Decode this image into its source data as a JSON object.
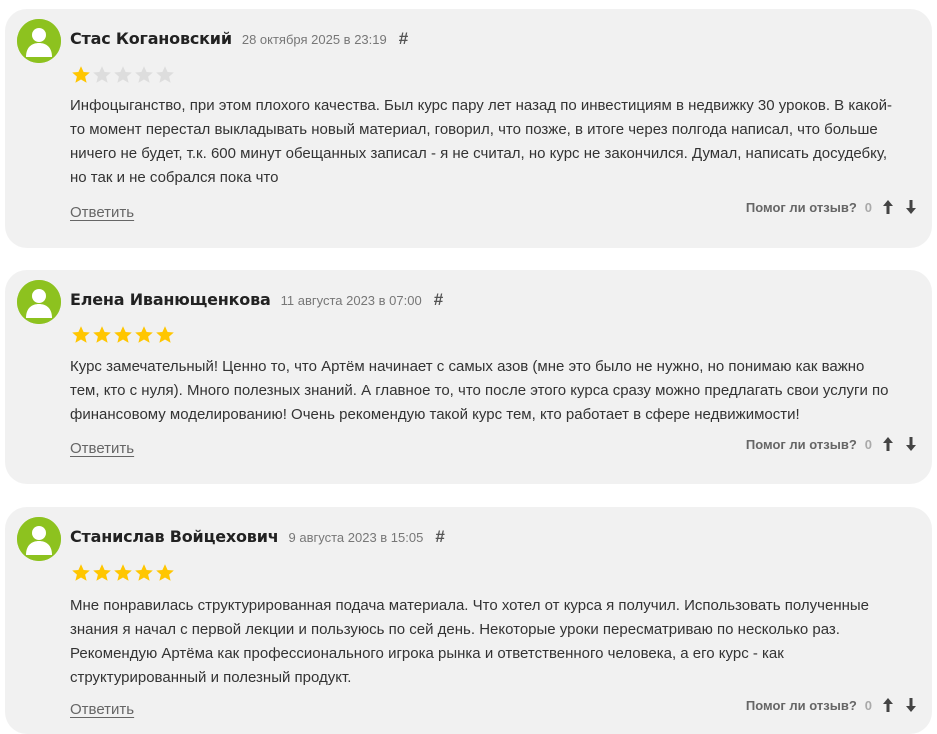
{
  "colors": {
    "card_bg": "#f1f1f1",
    "avatar_bg": "#8dc21f",
    "star_filled": "#ffc600",
    "star_empty": "#dddddd"
  },
  "reviews": [
    {
      "author": "Стас Когановский",
      "date": "28 октября 2025 в 23:19",
      "hash": "#",
      "rating": 1,
      "rating_max": 5,
      "text": "Инфоцыганство, при этом плохого качества. Был курс пару лет назад по инвестициям в недвижку 30 уроков. В какой-то момент перестал выкладывать новый материал, говорил, что позже, в итоге через полгода написал, что больше ничего не будет, т.к. 600 минут обещанных записал - я не считал, но курс не закончился. Думал, написать досудебку, но так и не собрался пока что",
      "reply_label": "Ответить",
      "helpful_label": "Помог ли отзыв?",
      "helpful_count": "0",
      "upvote_icon": "arrow-up-icon",
      "downvote_icon": "arrow-down-icon"
    },
    {
      "author": "Елена Иванющенкова",
      "date": "11 августа 2023 в 07:00",
      "hash": "#",
      "rating": 5,
      "rating_max": 5,
      "text": "Курс замечательный! Ценно то, что Артём начинает с самых азов (мне это было не нужно, но понимаю как важно тем, кто с нуля). Много полезных знаний. А главное то, что после этого курса сразу можно предлагать свои услуги по финансовому моделированию! Очень рекомендую такой курс тем, кто работает в сфере недвижимости!",
      "reply_label": "Ответить",
      "helpful_label": "Помог ли отзыв?",
      "helpful_count": "0",
      "upvote_icon": "arrow-up-icon",
      "downvote_icon": "arrow-down-icon"
    },
    {
      "author": "Станислав Войцехович",
      "date": "9 августа 2023 в 15:05",
      "hash": "#",
      "rating": 5,
      "rating_max": 5,
      "text": "Мне понравилась структурированная подача материала. Что хотел от курса я получил. Использовать полученные знания я начал с первой лекции и пользуюсь по сей день. Некоторые уроки пересматриваю по несколько раз. Рекомендую Артёма как профессионального игрока рынка и ответственного человека, а его курс - как структурированный и полезный продукт.",
      "reply_label": "Ответить",
      "helpful_label": "Помог ли отзыв?",
      "helpful_count": "0",
      "upvote_icon": "arrow-up-icon",
      "downvote_icon": "arrow-down-icon"
    }
  ]
}
